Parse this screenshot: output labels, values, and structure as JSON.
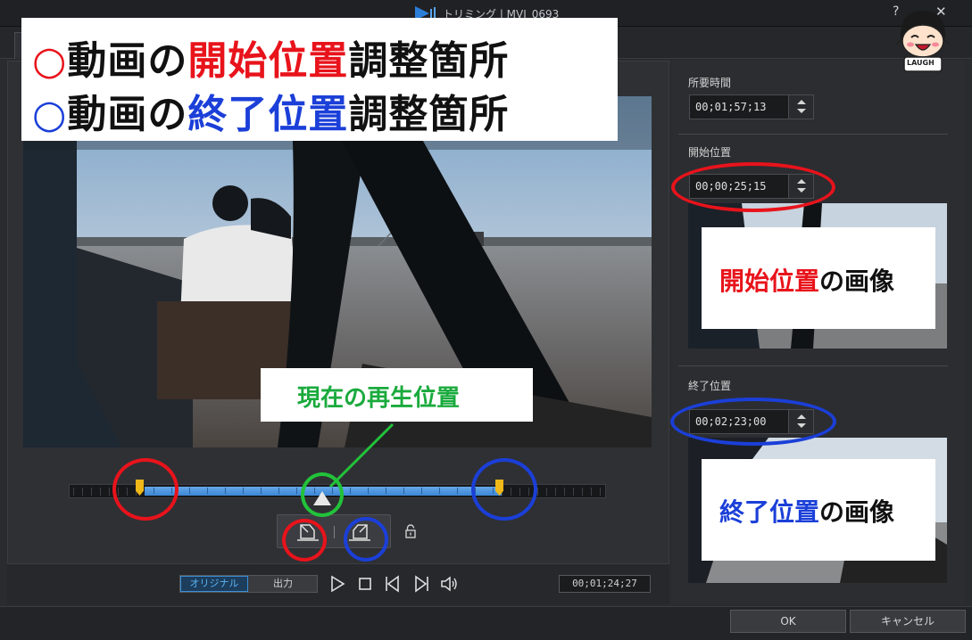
{
  "window": {
    "title": "トリミング | MVI_0693",
    "help_label": "?",
    "close_label": "✕"
  },
  "annotations": {
    "start_line": {
      "mark": "○",
      "pre": "動画の",
      "highlight": "開始位置",
      "post": "調整箇所"
    },
    "end_line": {
      "mark": "○",
      "pre": "動画の",
      "highlight": "終了位置",
      "post": "調整箇所"
    },
    "playhead_caption": "現在の再生位置",
    "start_image": {
      "highlight": "開始位置",
      "rest": "の画像"
    },
    "end_image": {
      "highlight": "終了位置",
      "rest": "の画像"
    },
    "mascot_text": "LAUGH"
  },
  "transport": {
    "original_label": "オリジナル",
    "output_label": "出力",
    "timecode": "00;01;24;27"
  },
  "panel": {
    "duration_label": "所要時間",
    "duration_value": "00;01;57;13",
    "start_label": "開始位置",
    "start_value": "00;00;25;15",
    "end_label": "終了位置",
    "end_value": "00;02;23;00"
  },
  "footer": {
    "ok_label": "OK",
    "cancel_label": "キャンセル"
  },
  "colors": {
    "start": "#e8131b",
    "end": "#1b3fd8",
    "playhead": "#1aaa3d",
    "selection": "#3a86d6",
    "marker": "#f0b818"
  },
  "icons": [
    "app-logo-icon",
    "play-icon",
    "stop-icon",
    "previous-frame-icon",
    "next-frame-icon",
    "volume-icon",
    "mark-in-icon",
    "mark-out-icon",
    "lock-icon"
  ]
}
